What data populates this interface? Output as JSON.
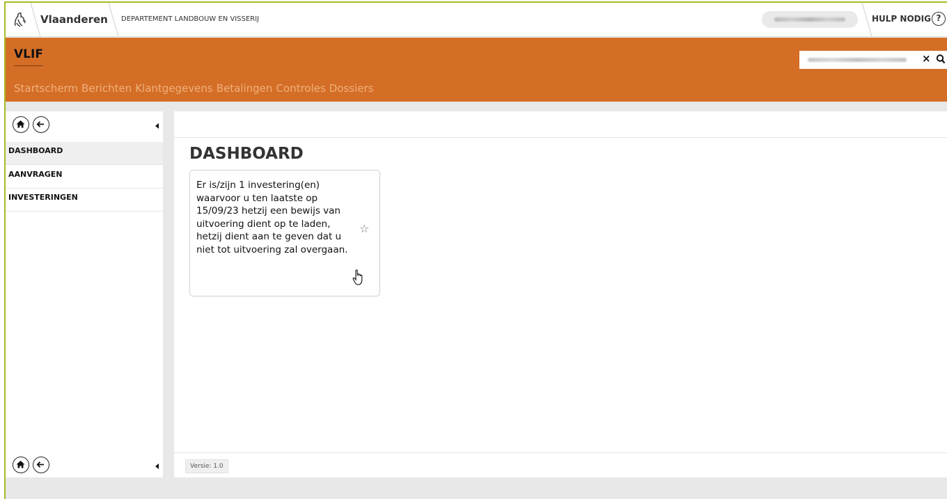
{
  "header": {
    "brand": "Vlaanderen",
    "department": "DEPARTEMENT LANDBOUW EN VISSERIJ",
    "help_label": "HULP NODIG",
    "help_icon_glyph": "?"
  },
  "app": {
    "name": "VLIF",
    "search_clear_glyph": "×",
    "nav": [
      "Startscherm",
      "Berichten",
      "Klantgegevens",
      "Betalingen",
      "Controles",
      "Dossiers"
    ]
  },
  "sidebar": {
    "items": [
      {
        "label": "DASHBOARD",
        "active": true
      },
      {
        "label": "AANVRAGEN",
        "active": false
      },
      {
        "label": "INVESTERINGEN",
        "active": false
      }
    ]
  },
  "main": {
    "title": "DASHBOARD",
    "card_text": "Er is/zijn 1 investering(en) waarvoor u ten laatste op 15/09/23 hetzij een bewijs van uitvoering dient op te laden, hetzij dient aan te geven dat u niet tot uitvoering zal overgaan.",
    "star_glyph": "☆",
    "version": "Versie: 1.0"
  },
  "colors": {
    "accent_orange": "#d46e27",
    "nav_text": "#f0b07a",
    "frame_green": "#a9b927"
  }
}
